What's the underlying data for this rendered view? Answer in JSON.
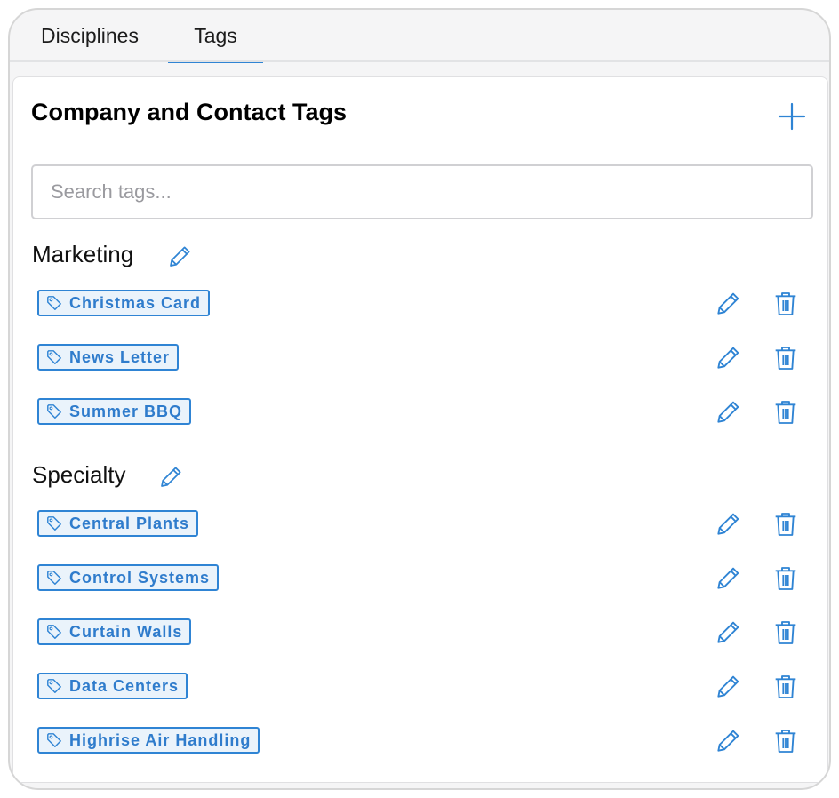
{
  "tabs": [
    {
      "label": "Disciplines",
      "active": false
    },
    {
      "label": "Tags",
      "active": true
    }
  ],
  "card": {
    "title": "Company and Contact Tags"
  },
  "search": {
    "placeholder": "Search tags...",
    "value": ""
  },
  "groups": [
    {
      "name": "Marketing",
      "tags": [
        "Christmas Card",
        "News Letter",
        "Summer BBQ"
      ]
    },
    {
      "name": "Specialty",
      "tags": [
        "Central Plants",
        "Control Systems",
        "Curtain Walls",
        "Data Centers",
        "Highrise Air Handling"
      ]
    }
  ],
  "colors": {
    "accent": "#2f84d4",
    "tag_background": "#eaf3fb",
    "tab_underline": "#2f84d4"
  },
  "icons": {
    "add": "plus-icon",
    "edit": "pencil-icon",
    "delete": "trash-icon",
    "tag": "tag-icon"
  }
}
